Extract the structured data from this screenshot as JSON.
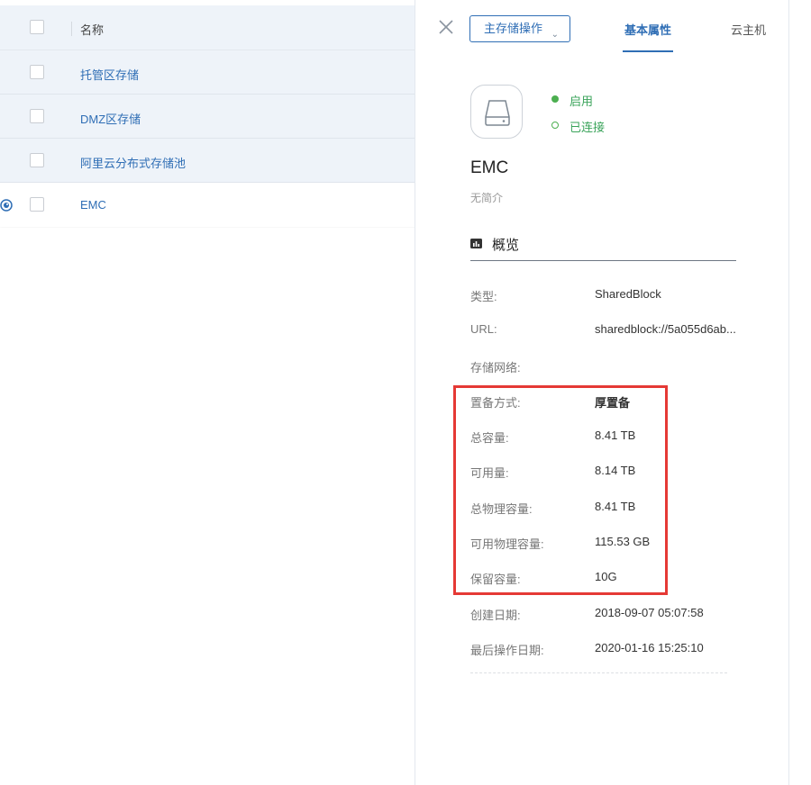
{
  "list": {
    "header_label": "名称",
    "rows": [
      {
        "name": "托管区存储"
      },
      {
        "name": "DMZ区存储"
      },
      {
        "name": "阿里云分布式存储池"
      },
      {
        "name": "EMC"
      }
    ]
  },
  "detail": {
    "ops_button": "主存储操作",
    "tabs": [
      "基本属性",
      "云主机"
    ],
    "status_enabled": "启用",
    "status_connected": "已连接",
    "title": "EMC",
    "description": "无简介",
    "section_title": "概览",
    "fields": [
      {
        "label": "类型:",
        "value": "SharedBlock"
      },
      {
        "label": "URL:",
        "value": "sharedblock://5a055d6ab..."
      },
      {
        "label": "存储网络:",
        "value": ""
      },
      {
        "label": "置备方式:",
        "value": "厚置备"
      },
      {
        "label": "总容量:",
        "value": "8.41 TB"
      },
      {
        "label": "可用量:",
        "value": "8.14 TB"
      },
      {
        "label": "总物理容量:",
        "value": "8.41 TB"
      },
      {
        "label": "可用物理容量:",
        "value": "115.53 GB"
      },
      {
        "label": "保留容量:",
        "value": "10G"
      },
      {
        "label": "创建日期:",
        "value": "2018-09-07 05:07:58"
      },
      {
        "label": "最后操作日期:",
        "value": "2020-01-16 15:25:10"
      }
    ]
  },
  "colors": {
    "accent": "#2f6eb5",
    "status_green": "#4caf50",
    "highlight_red": "#e53935",
    "list_bg": "#eef3f9"
  }
}
